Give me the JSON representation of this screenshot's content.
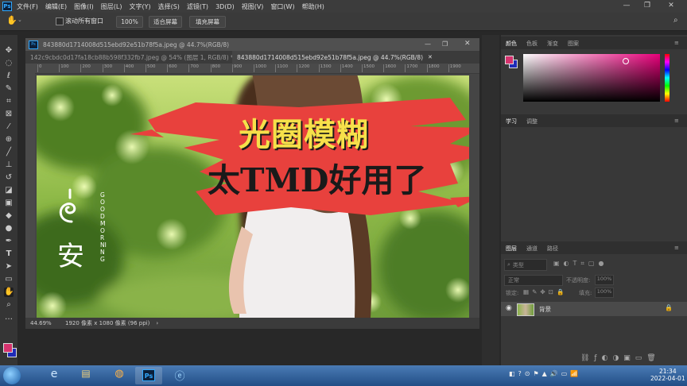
{
  "menu": {
    "logo": "Ps",
    "items": [
      "文件(F)",
      "编辑(E)",
      "图像(I)",
      "图层(L)",
      "文字(Y)",
      "选择(S)",
      "滤镜(T)",
      "3D(D)",
      "视图(V)",
      "窗口(W)",
      "帮助(H)"
    ],
    "controls": [
      "—",
      "❐",
      "✕"
    ]
  },
  "options": {
    "checkbox_label": "滚动所有窗口",
    "zoom_btn": "100%",
    "fit_btn": "适合屏幕",
    "fill_btn": "填充屏幕"
  },
  "document": {
    "window_title": "843880d1714008d515ebd92e51b78f5a.jpeg @ 44.7%(RGB/8)",
    "tabs": [
      {
        "label": "142c9cbdc0d17fa18cb88b598f332fb7.jpeg @ 54% (图层 1, RGB/8) *",
        "close": "✕",
        "active": false
      },
      {
        "label": "843880d1714008d515ebd92e51b78f5a.jpeg @ 44.7%(RGB/8)",
        "close": "✕",
        "active": true
      }
    ],
    "ruler_ticks": [
      "0",
      "100",
      "200",
      "300",
      "400",
      "500",
      "600",
      "700",
      "800",
      "900",
      "1000",
      "1100",
      "1200",
      "1300",
      "1400",
      "1500",
      "1600",
      "1700",
      "1800",
      "1900"
    ],
    "status_zoom": "44.69%",
    "status_info": "1920 像素 x 1080 像素 (96 ppi)",
    "status_arrow": "›"
  },
  "overlay": {
    "line1": "光圈模糊",
    "line2": "太TMD好用了",
    "logo_char": "安",
    "logo_text": "GOODMORNING"
  },
  "panels": {
    "color_tabs": [
      "颜色",
      "色板",
      "渐变",
      "图案"
    ],
    "learn_tabs": [
      "学习",
      "调整"
    ],
    "layers_tabs": [
      "图层",
      "通道",
      "路径"
    ],
    "filter_placeholder": "类型",
    "blend_mode": "正常",
    "opacity_label": "不透明度:",
    "opacity_value": "100%",
    "lock_label": "锁定:",
    "fill_label": "填充:",
    "fill_value": "100%",
    "layer_name": "背景"
  },
  "colors": {
    "foreground": "#d6326e",
    "background": "#1f2bb8",
    "picker_hue": "#e8007a",
    "accent_red": "#e8413d",
    "title_yellow": "#f6e04a"
  },
  "taskbar": {
    "time": "21:34",
    "date": "2022-04-01",
    "ps_label": "Ps"
  }
}
